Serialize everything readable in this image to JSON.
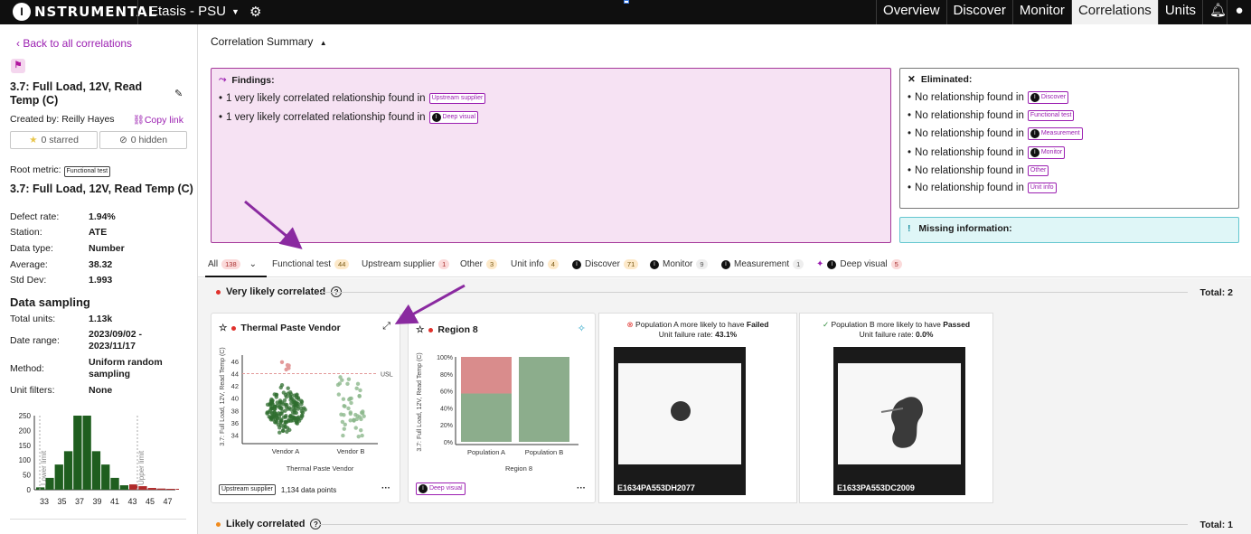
{
  "nav": {
    "logo_text": "NSTRUMENTAL",
    "logo_badge": "I",
    "project": "Etasis - PSU",
    "tabs": [
      "Overview",
      "Discover",
      "Monitor",
      "Correlations",
      "Units"
    ],
    "active_tab": "Correlations"
  },
  "sidebar": {
    "back_link": "‹  Back to all correlations",
    "title": "3.7: Full Load, 12V, Read Temp (C)",
    "created_by": "Created by: Reilly Hayes",
    "copy_link": "Copy link",
    "starred": "0 starred",
    "hidden": "0 hidden",
    "root_metric_label": "Root metric:",
    "root_metric_tag": "Functional test",
    "root_metric_title": "3.7: Full Load, 12V, Read Temp (C)",
    "stats": [
      {
        "k": "Defect rate:",
        "v": "1.94%"
      },
      {
        "k": "Station:",
        "v": "ATE"
      },
      {
        "k": "Data type:",
        "v": "Number"
      },
      {
        "k": "Average:",
        "v": "38.32"
      },
      {
        "k": "Std Dev:",
        "v": "1.993"
      }
    ],
    "data_sampling_title": "Data sampling",
    "sampling": [
      {
        "k": "Total units:",
        "v": "1.13k"
      },
      {
        "k": "Date range:",
        "v": "2023/09/02 - 2023/11/17"
      },
      {
        "k": "Method:",
        "v": "Uniform random sampling"
      },
      {
        "k": "Unit filters:",
        "v": "None"
      }
    ],
    "histogram": {
      "y_ticks": [
        "250",
        "200",
        "150",
        "100",
        "50",
        "0"
      ],
      "x_ticks": [
        "33",
        "35",
        "37",
        "39",
        "41",
        "43",
        "45",
        "47"
      ],
      "lower_limit": "Lower limit",
      "upper_limit": "Upper limit",
      "bins_green": [
        8,
        40,
        85,
        130,
        250,
        250,
        130,
        85,
        40,
        15
      ],
      "bins_red": [
        18,
        12,
        6,
        4,
        3,
        3
      ]
    }
  },
  "summary": {
    "title": "Correlation Summary",
    "findings_head": "Findings:",
    "findings": [
      {
        "text": "1 very likely correlated relationship found in",
        "tag": "Upstream supplier"
      },
      {
        "text": "1 very likely correlated relationship found in",
        "tag": "Deep visual"
      }
    ],
    "eliminated_head": "Eliminated:",
    "eliminated": [
      {
        "text": "No relationship found in",
        "tag": "Discover"
      },
      {
        "text": "No relationship found in",
        "tag": "Functional test"
      },
      {
        "text": "No relationship found in",
        "tag": "Measurement"
      },
      {
        "text": "No relationship found in",
        "tag": "Monitor"
      },
      {
        "text": "No relationship found in",
        "tag": "Other"
      },
      {
        "text": "No relationship found in",
        "tag": "Unit info"
      }
    ],
    "missing_head": "Missing information:"
  },
  "filter_tabs": [
    {
      "label": "All",
      "count": "138"
    },
    {
      "label": "Functional test",
      "count": "44"
    },
    {
      "label": "Upstream supplier",
      "count": "1"
    },
    {
      "label": "Other",
      "count": "3"
    },
    {
      "label": "Unit info",
      "count": "4"
    },
    {
      "label": "Discover",
      "count": "71"
    },
    {
      "label": "Monitor",
      "count": "9"
    },
    {
      "label": "Measurement",
      "count": "1"
    },
    {
      "label": "Deep visual",
      "count": "5"
    }
  ],
  "sections": {
    "very_likely": "Very likely correlated",
    "very_likely_total": "Total: 2",
    "likely": "Likely correlated",
    "likely_total": "Total: 1"
  },
  "card1": {
    "title": "Thermal Paste Vendor",
    "y_label": "3.7: Full Load, 12V, Read Temp (C)",
    "x_label": "Thermal Paste Vendor",
    "y_ticks": [
      "46",
      "44",
      "42",
      "40",
      "38",
      "36",
      "34"
    ],
    "x_ticks": [
      "Vendor A",
      "Vendor B"
    ],
    "usl": "USL",
    "tag": "Upstream supplier",
    "points": "1,134 data points"
  },
  "card2": {
    "title": "Region 8",
    "y_label": "3.7: Full Load, 12V, Read Temp (C)",
    "x_label": "Region 8",
    "y_ticks": [
      "100%",
      "80%",
      "60%",
      "40%",
      "20%",
      "0%"
    ],
    "x_ticks": [
      "Population A",
      "Population B"
    ],
    "tag": "Deep visual"
  },
  "chart_data": {
    "type": "bar",
    "categories": [
      "Population A",
      "Population B"
    ],
    "series": [
      {
        "name": "Failed",
        "values": [
          43.1,
          0.0
        ]
      },
      {
        "name": "Passed",
        "values": [
          56.9,
          100.0
        ]
      }
    ],
    "xlabel": "Region 8",
    "ylabel": "3.7: Full Load, 12V, Read Temp (C)",
    "ylim": [
      0,
      100
    ]
  },
  "img1": {
    "head": "Population A more likely to have",
    "head_bold": "Failed",
    "rate": "Unit failure rate:",
    "rate_val": "43.1%",
    "label": "E1634PA553DH2077"
  },
  "img2": {
    "head": "Population B more likely to have",
    "head_bold": "Passed",
    "rate": "Unit failure rate:",
    "rate_val": "0.0%",
    "label": "E1633PA553DC2009"
  }
}
